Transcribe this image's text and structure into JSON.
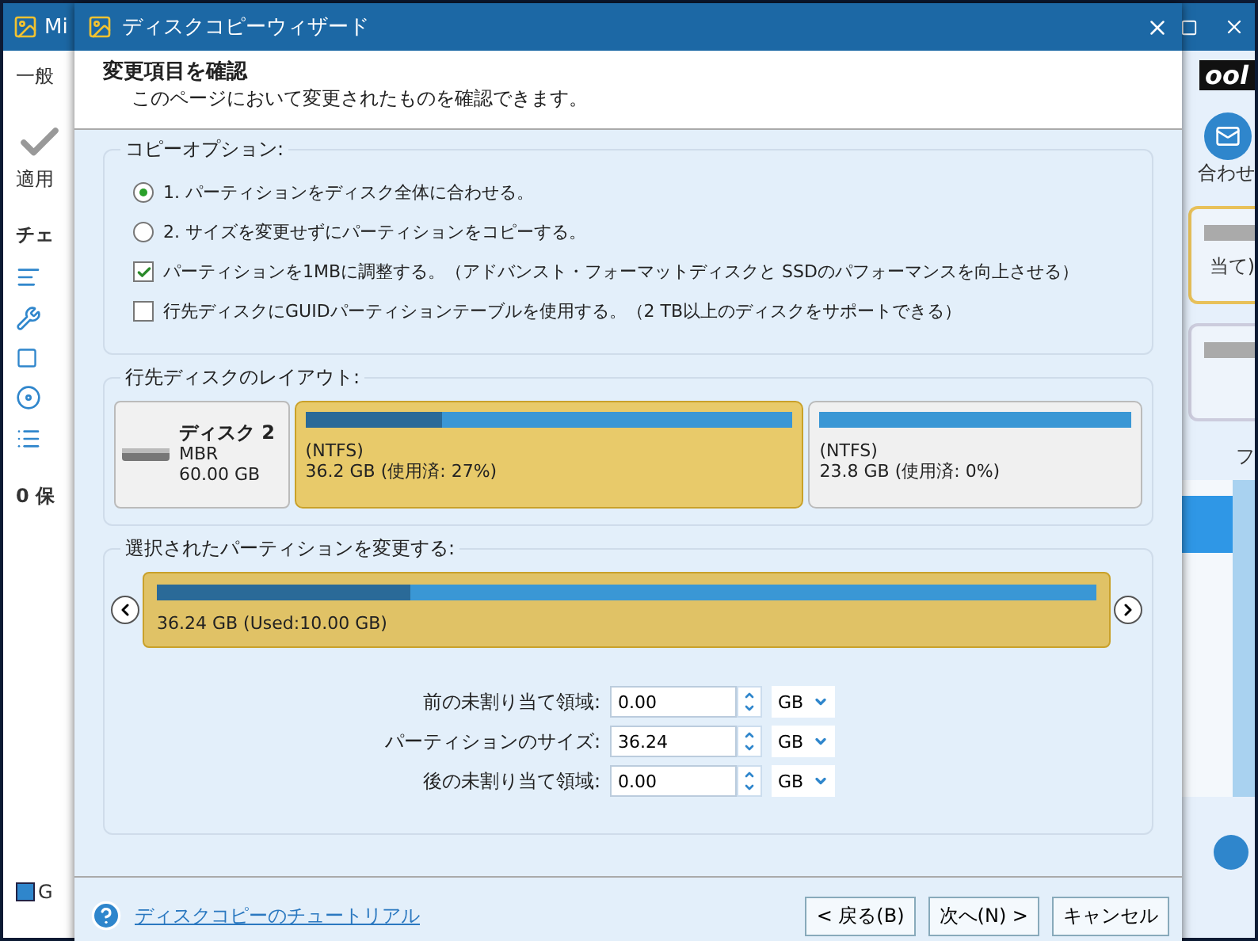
{
  "background": {
    "title": "Mi",
    "left": {
      "tab": "一般",
      "apply_label": "適用",
      "section": "チェ",
      "count_label": "0 保",
      "legend": "G"
    },
    "right": {
      "logo": "ool",
      "contact_label": "合わせ",
      "card_text": "当て)",
      "column_label": "フ"
    }
  },
  "dialog": {
    "title": "ディスクコピーウィザード",
    "heading": "変更項目を確認",
    "subheading": "このページにおいて変更されたものを確認できます。",
    "copy_options": {
      "title": "コピーオプション:",
      "options": [
        {
          "kind": "radio",
          "label": "1. パーティションをディスク全体に合わせる。",
          "selected": true
        },
        {
          "kind": "radio",
          "label": "2. サイズを変更せずにパーティションをコピーする。",
          "selected": false
        },
        {
          "kind": "checkbox",
          "label": "パーティションを1MBに調整する。（アドバンスト・フォーマットディスクと SSDのパフォーマンスを向上させる）",
          "checked": true
        },
        {
          "kind": "checkbox",
          "label": "行先ディスクにGUIDパーティションテーブルを使用する。（2 TB以上のディスクをサポートできる）",
          "checked": false
        }
      ]
    },
    "layout": {
      "title": "行先ディスクのレイアウト:",
      "disk": {
        "name": "ディスク 2",
        "type": "MBR",
        "size": "60.00 GB"
      },
      "partitions": [
        {
          "fs": "(NTFS)",
          "info": "36.2 GB (使用済: 27%)",
          "level": 0.28,
          "selected": true
        },
        {
          "fs": "(NTFS)",
          "info": "23.8 GB (使用済: 0%)",
          "level": 0,
          "selected": false
        }
      ]
    },
    "resize": {
      "title": "選択されたパーティションを変更する:",
      "bar_label": "36.24 GB (Used:10.00 GB)",
      "level": 0.27,
      "fields": [
        {
          "label": "前の未割り当て領域:",
          "value": "0.00",
          "unit": "GB"
        },
        {
          "label": "パーティションのサイズ:",
          "value": "36.24",
          "unit": "GB"
        },
        {
          "label": "後の未割り当て領域:",
          "value": "0.00",
          "unit": "GB"
        }
      ]
    },
    "help_link": "ディスクコピーのチュートリアル",
    "buttons": [
      "< 戻る(B)",
      "次へ(N) >",
      "キャンセル"
    ]
  }
}
